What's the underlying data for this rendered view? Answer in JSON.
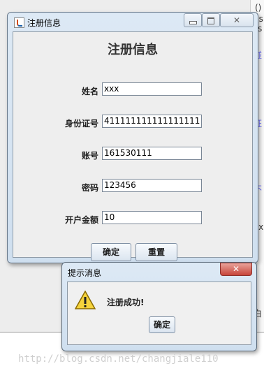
{
  "background": {
    "fragments": [
      "()",
      "ns",
      "x",
      "s",
      "碰",
      "证",
      "不",
      "ex",
      "k",
      "白"
    ]
  },
  "main_window": {
    "title": "注册信息",
    "heading": "注册信息",
    "fields": [
      {
        "label": "姓名",
        "value": "xxx"
      },
      {
        "label": "身份证号",
        "value": "411111111111111111"
      },
      {
        "label": "账号",
        "value": "161530111"
      },
      {
        "label": "密码",
        "value": "123456"
      },
      {
        "label": "开户金额",
        "value": "10"
      }
    ],
    "buttons": {
      "confirm": "确定",
      "reset": "重置"
    }
  },
  "message_dialog": {
    "title": "提示消息",
    "icon": "warning-icon",
    "message": "注册成功!",
    "ok": "确定"
  },
  "watermark": "http://blog.csdn.net/changjiale110",
  "colors": {
    "title_bar": "#dde9f5",
    "close_red": "#c7453a",
    "warning_yellow": "#f5d33c"
  }
}
